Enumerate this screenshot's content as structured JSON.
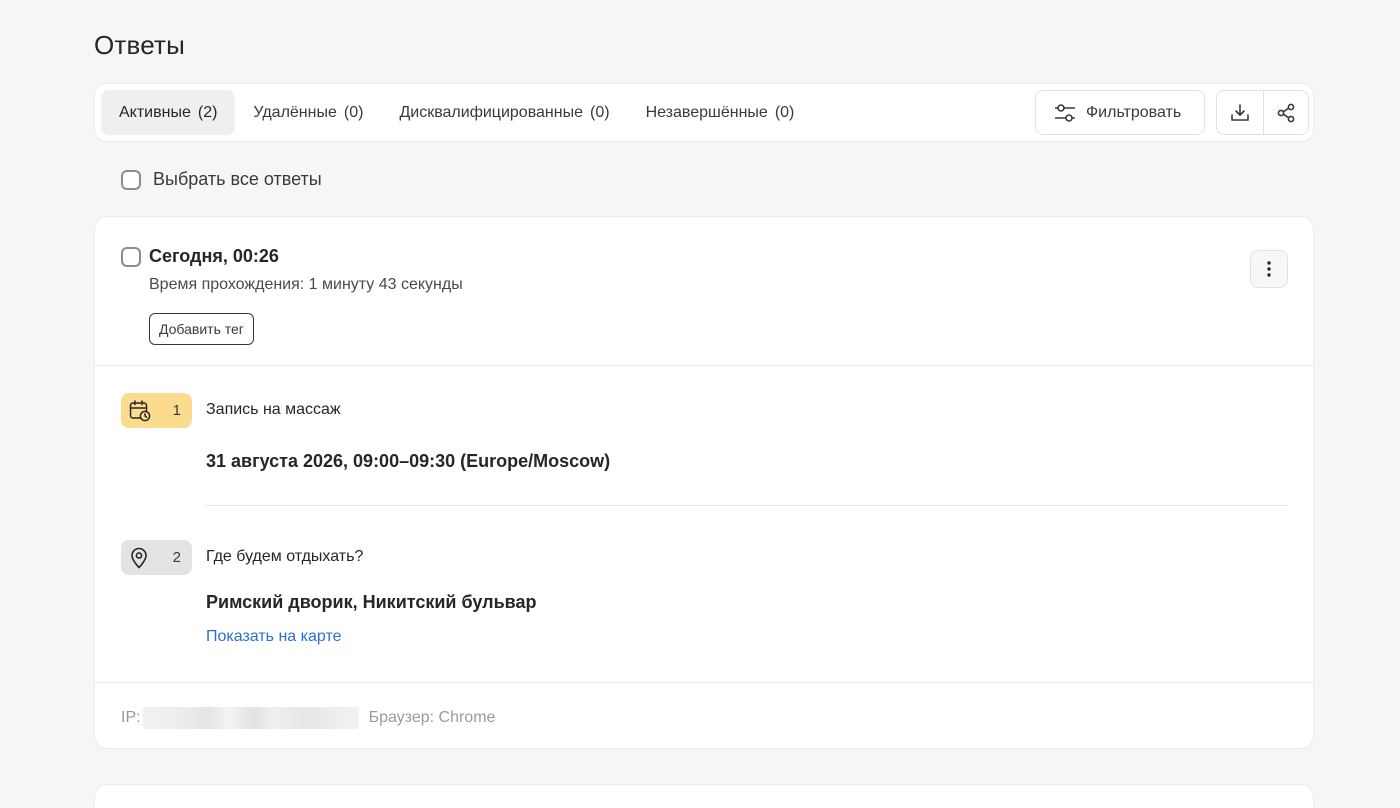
{
  "page": {
    "title": "Ответы"
  },
  "tabs": [
    {
      "label": "Активные",
      "count": "(2)",
      "active": true
    },
    {
      "label": "Удалённые",
      "count": "(0)",
      "active": false
    },
    {
      "label": "Дисквалифицированные",
      "count": "(0)",
      "active": false
    },
    {
      "label": "Незавершённые",
      "count": "(0)",
      "active": false
    }
  ],
  "toolbar": {
    "filter_label": "Фильтровать",
    "download_icon": "download-icon",
    "share_icon": "share-icon"
  },
  "select_all": {
    "label": "Выбрать все ответы",
    "checked": false
  },
  "response": {
    "date": "Сегодня, 00:26",
    "duration": "Время прохождения: 1 минуту 43 секунды",
    "add_tag_label": "Добавить тег",
    "questions": [
      {
        "number": "1",
        "icon": "calendar-clock-icon",
        "badge_color": "#fbdc8e",
        "title": "Запись на массаж",
        "answer": "31 августа 2026, 09:00–09:30 (Europe/Moscow)"
      },
      {
        "number": "2",
        "icon": "location-pin-icon",
        "badge_color": "#e3e3e3",
        "title": "Где будем отдыхать?",
        "answer": "Римский дворик, Никитский бульвар",
        "link_label": "Показать на карте"
      }
    ],
    "meta": {
      "ip_label": "IP:",
      "browser": "Браузер: Chrome"
    }
  },
  "colors": {
    "accent_link": "#2b6fd6",
    "background": "#f6f6f6"
  }
}
